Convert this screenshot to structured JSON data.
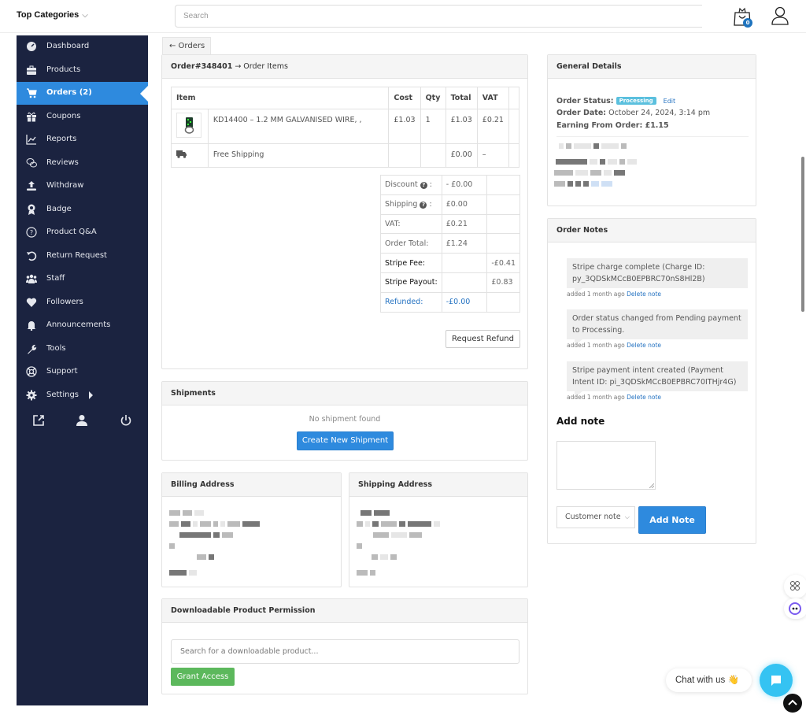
{
  "topbar": {
    "categories_label": "Top Categories",
    "search_placeholder": "Search",
    "cart_count": "0"
  },
  "sidebar": {
    "items": [
      {
        "label": "Dashboard",
        "icon": "dashboard-icon"
      },
      {
        "label": "Products",
        "icon": "briefcase-icon"
      },
      {
        "label": "Orders (2)",
        "icon": "cart-icon",
        "active": true
      },
      {
        "label": "Coupons",
        "icon": "gift-icon"
      },
      {
        "label": "Reports",
        "icon": "chart-line-icon"
      },
      {
        "label": "Reviews",
        "icon": "comments-icon"
      },
      {
        "label": "Withdraw",
        "icon": "upload-icon"
      },
      {
        "label": "Badge",
        "icon": "badge-icon"
      },
      {
        "label": "Product Q&A",
        "icon": "question-circle-icon"
      },
      {
        "label": "Return Request",
        "icon": "undo-icon"
      },
      {
        "label": "Staff",
        "icon": "users-icon"
      },
      {
        "label": "Followers",
        "icon": "heart-icon"
      },
      {
        "label": "Announcements",
        "icon": "bell-icon"
      },
      {
        "label": "Tools",
        "icon": "wrench-icon"
      },
      {
        "label": "Support",
        "icon": "life-ring-icon"
      },
      {
        "label": "Settings",
        "icon": "gear-icon"
      }
    ],
    "footer_icons": [
      "external-link-icon",
      "user-icon",
      "power-icon"
    ]
  },
  "back_link": "← Orders",
  "order_items": {
    "order_number": "Order#348401",
    "title_suffix": " → Order Items",
    "columns": [
      "Item",
      "Cost",
      "Qty",
      "Total",
      "VAT"
    ],
    "rows": [
      {
        "name": "KD14400 – 1.2 MM GALVANISED WIRE, ,",
        "cost": "£1.03",
        "qty": "1",
        "total": "£1.03",
        "vat": "£0.21"
      },
      {
        "name": "Free Shipping",
        "cost": "",
        "qty": "",
        "total": "£0.00",
        "vat": "–"
      }
    ],
    "totals": [
      {
        "label": "Discount ❓ :",
        "value": "- £0.00",
        "extra": ""
      },
      {
        "label": "Shipping ❓ :",
        "value": "£0.00",
        "extra": ""
      },
      {
        "label": "VAT:",
        "value": "£0.21",
        "extra": ""
      },
      {
        "label": "Order Total:",
        "value": "£1.24",
        "extra": ""
      },
      {
        "label": "Stripe Fee:",
        "value": "",
        "extra": "-£0.41"
      },
      {
        "label": "Stripe Payout:",
        "value": "",
        "extra": "£0.83"
      },
      {
        "label": "Refunded:",
        "value": "-£0.00",
        "extra": ""
      }
    ],
    "refund_button": "Request Refund"
  },
  "shipments": {
    "title": "Shipments",
    "empty_text": "No shipment found",
    "create_button": "Create New Shipment"
  },
  "billing": {
    "title": "Billing Address"
  },
  "shipping": {
    "title": "Shipping Address"
  },
  "downloads": {
    "title": "Downloadable Product Permission",
    "search_placeholder": "Search for a downloadable product...",
    "grant_button": "Grant Access"
  },
  "general": {
    "title": "General Details",
    "status_label": "Order Status:",
    "status_value": "Processing",
    "status_color": "#5bc0de",
    "edit_link": "Edit",
    "date_label": "Order Date:",
    "date_value": "October 24, 2024, 3:14 pm",
    "earning_label": "Earning From Order:",
    "earning_value": "£1.15"
  },
  "notes": {
    "title": "Order Notes",
    "items": [
      {
        "text": "Stripe charge complete (Charge ID: py_3QDSkMCcB0EPBRC70nS8Hl2B)",
        "meta": "added 1 month ago",
        "delete": "Delete note"
      },
      {
        "text": "Order status changed from Pending payment to Processing.",
        "meta": "added 1 month ago",
        "delete": "Delete note"
      },
      {
        "text": "Stripe payment intent created (Payment Intent ID: pi_3QDSkMCcB0EPBRC70ITHjr4G)",
        "meta": "added 1 month ago",
        "delete": "Delete note"
      }
    ],
    "add_note_heading": "Add note",
    "note_type_selected": "Customer note",
    "add_note_button": "Add Note"
  },
  "chat": {
    "label": "Chat with us 👋"
  },
  "colors": {
    "sidebar_bg": "#1b2340",
    "accent_blue": "#2e8ade",
    "grant_green": "#5cb85c",
    "chat_cyan": "#35c3f2"
  }
}
